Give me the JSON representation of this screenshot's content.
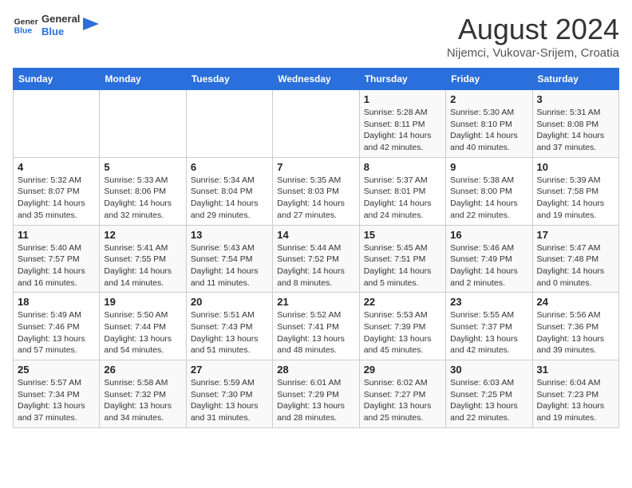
{
  "header": {
    "logo_line1": "General",
    "logo_line2": "Blue",
    "month": "August 2024",
    "location": "Nijemci, Vukovar-Srijem, Croatia"
  },
  "days_of_week": [
    "Sunday",
    "Monday",
    "Tuesday",
    "Wednesday",
    "Thursday",
    "Friday",
    "Saturday"
  ],
  "weeks": [
    [
      {
        "day": "",
        "info": ""
      },
      {
        "day": "",
        "info": ""
      },
      {
        "day": "",
        "info": ""
      },
      {
        "day": "",
        "info": ""
      },
      {
        "day": "1",
        "info": "Sunrise: 5:28 AM\nSunset: 8:11 PM\nDaylight: 14 hours\nand 42 minutes."
      },
      {
        "day": "2",
        "info": "Sunrise: 5:30 AM\nSunset: 8:10 PM\nDaylight: 14 hours\nand 40 minutes."
      },
      {
        "day": "3",
        "info": "Sunrise: 5:31 AM\nSunset: 8:08 PM\nDaylight: 14 hours\nand 37 minutes."
      }
    ],
    [
      {
        "day": "4",
        "info": "Sunrise: 5:32 AM\nSunset: 8:07 PM\nDaylight: 14 hours\nand 35 minutes."
      },
      {
        "day": "5",
        "info": "Sunrise: 5:33 AM\nSunset: 8:06 PM\nDaylight: 14 hours\nand 32 minutes."
      },
      {
        "day": "6",
        "info": "Sunrise: 5:34 AM\nSunset: 8:04 PM\nDaylight: 14 hours\nand 29 minutes."
      },
      {
        "day": "7",
        "info": "Sunrise: 5:35 AM\nSunset: 8:03 PM\nDaylight: 14 hours\nand 27 minutes."
      },
      {
        "day": "8",
        "info": "Sunrise: 5:37 AM\nSunset: 8:01 PM\nDaylight: 14 hours\nand 24 minutes."
      },
      {
        "day": "9",
        "info": "Sunrise: 5:38 AM\nSunset: 8:00 PM\nDaylight: 14 hours\nand 22 minutes."
      },
      {
        "day": "10",
        "info": "Sunrise: 5:39 AM\nSunset: 7:58 PM\nDaylight: 14 hours\nand 19 minutes."
      }
    ],
    [
      {
        "day": "11",
        "info": "Sunrise: 5:40 AM\nSunset: 7:57 PM\nDaylight: 14 hours\nand 16 minutes."
      },
      {
        "day": "12",
        "info": "Sunrise: 5:41 AM\nSunset: 7:55 PM\nDaylight: 14 hours\nand 14 minutes."
      },
      {
        "day": "13",
        "info": "Sunrise: 5:43 AM\nSunset: 7:54 PM\nDaylight: 14 hours\nand 11 minutes."
      },
      {
        "day": "14",
        "info": "Sunrise: 5:44 AM\nSunset: 7:52 PM\nDaylight: 14 hours\nand 8 minutes."
      },
      {
        "day": "15",
        "info": "Sunrise: 5:45 AM\nSunset: 7:51 PM\nDaylight: 14 hours\nand 5 minutes."
      },
      {
        "day": "16",
        "info": "Sunrise: 5:46 AM\nSunset: 7:49 PM\nDaylight: 14 hours\nand 2 minutes."
      },
      {
        "day": "17",
        "info": "Sunrise: 5:47 AM\nSunset: 7:48 PM\nDaylight: 14 hours\nand 0 minutes."
      }
    ],
    [
      {
        "day": "18",
        "info": "Sunrise: 5:49 AM\nSunset: 7:46 PM\nDaylight: 13 hours\nand 57 minutes."
      },
      {
        "day": "19",
        "info": "Sunrise: 5:50 AM\nSunset: 7:44 PM\nDaylight: 13 hours\nand 54 minutes."
      },
      {
        "day": "20",
        "info": "Sunrise: 5:51 AM\nSunset: 7:43 PM\nDaylight: 13 hours\nand 51 minutes."
      },
      {
        "day": "21",
        "info": "Sunrise: 5:52 AM\nSunset: 7:41 PM\nDaylight: 13 hours\nand 48 minutes."
      },
      {
        "day": "22",
        "info": "Sunrise: 5:53 AM\nSunset: 7:39 PM\nDaylight: 13 hours\nand 45 minutes."
      },
      {
        "day": "23",
        "info": "Sunrise: 5:55 AM\nSunset: 7:37 PM\nDaylight: 13 hours\nand 42 minutes."
      },
      {
        "day": "24",
        "info": "Sunrise: 5:56 AM\nSunset: 7:36 PM\nDaylight: 13 hours\nand 39 minutes."
      }
    ],
    [
      {
        "day": "25",
        "info": "Sunrise: 5:57 AM\nSunset: 7:34 PM\nDaylight: 13 hours\nand 37 minutes."
      },
      {
        "day": "26",
        "info": "Sunrise: 5:58 AM\nSunset: 7:32 PM\nDaylight: 13 hours\nand 34 minutes."
      },
      {
        "day": "27",
        "info": "Sunrise: 5:59 AM\nSunset: 7:30 PM\nDaylight: 13 hours\nand 31 minutes."
      },
      {
        "day": "28",
        "info": "Sunrise: 6:01 AM\nSunset: 7:29 PM\nDaylight: 13 hours\nand 28 minutes."
      },
      {
        "day": "29",
        "info": "Sunrise: 6:02 AM\nSunset: 7:27 PM\nDaylight: 13 hours\nand 25 minutes."
      },
      {
        "day": "30",
        "info": "Sunrise: 6:03 AM\nSunset: 7:25 PM\nDaylight: 13 hours\nand 22 minutes."
      },
      {
        "day": "31",
        "info": "Sunrise: 6:04 AM\nSunset: 7:23 PM\nDaylight: 13 hours\nand 19 minutes."
      }
    ]
  ]
}
